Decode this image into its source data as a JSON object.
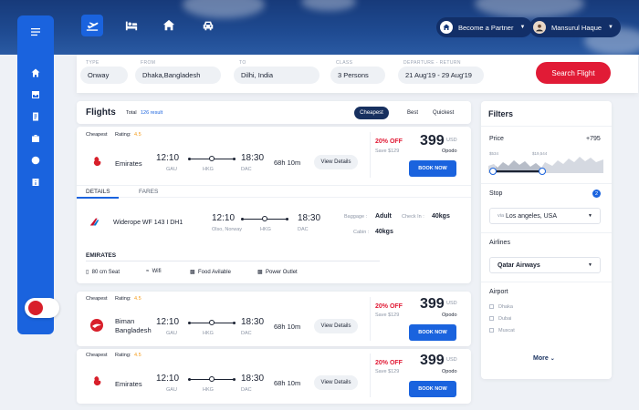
{
  "header": {
    "partner_label": "Become a Partner",
    "user_name": "Mansurul Haque",
    "nav_icons": [
      "flight-icon",
      "hotel-icon",
      "home-icon",
      "car-icon"
    ]
  },
  "search": {
    "type_label": "TYPE",
    "type_value": "Onway",
    "from_label": "FROM",
    "from_value": "Dhaka,Bangladesh",
    "to_label": "TO",
    "to_value": "Dilhi, India",
    "class_label": "CLASS",
    "class_value": "3 Persons",
    "dates_label": "DEPARTURE - RETURN",
    "dates_value": "21 Aug'19  -  29 Aug'19",
    "button": "Search  Flight"
  },
  "flights": {
    "title": "Flights",
    "total_label": "Total",
    "total_count": "126 result",
    "sort_tabs": [
      "Cheapest",
      "Best",
      "Quickest"
    ],
    "details_tabs": [
      "DETAILS",
      "FARES"
    ],
    "items": [
      {
        "tag": "Cheapest",
        "rating_label": "Rating:",
        "rating": "4.5",
        "airline": "Emirates",
        "dep_time": "12:10",
        "dep_code": "GAU",
        "stop_code": "HKG",
        "arr_time": "18:30",
        "arr_code": "DAC",
        "duration": "68h 10m",
        "discount": "20% OFF",
        "save": "Save $129",
        "price": "399",
        "currency": "USD",
        "agent": "Opodo",
        "view": "View Details",
        "book": "BOOK NOW"
      },
      {
        "tag": "Cheapest",
        "rating_label": "Rating:",
        "rating": "4.5",
        "airline": "Biman Bangladesh",
        "dep_time": "12:10",
        "dep_code": "GAU",
        "stop_code": "HKG",
        "arr_time": "18:30",
        "arr_code": "DAC",
        "duration": "68h 10m",
        "discount": "20% OFF",
        "save": "Save $129",
        "price": "399",
        "currency": "USD",
        "agent": "Opodo",
        "view": "View Details",
        "book": "BOOK NOW"
      },
      {
        "tag": "Cheapest",
        "rating_label": "Rating:",
        "rating": "4.5",
        "airline": "Emirates",
        "dep_time": "12:10",
        "dep_code": "GAU",
        "stop_code": "HKG",
        "arr_time": "18:30",
        "arr_code": "DAC",
        "duration": "68h 10m",
        "discount": "20% OFF",
        "save": "Save $129",
        "price": "399",
        "currency": "USD",
        "agent": "Opodo",
        "view": "View Details",
        "book": "BOOK NOW"
      }
    ],
    "detail": {
      "flight": "Widerope WF 143 I DH1",
      "dep_time": "12:10",
      "dep_loc": "Olso, Norway",
      "stop": "HKG",
      "arr_time": "18:30",
      "arr_code": "DAC",
      "baggage_label": "Baggage :",
      "baggage_value": "Adult",
      "checkin_label": "Check In :",
      "checkin_value": "40kgs",
      "cabin_label": "Cabin :",
      "cabin_value": "40kgs",
      "section": "EMIRATES",
      "amenities": [
        "80 cm Seat",
        "Wifi",
        "Food Avilable",
        "Power Outlet"
      ]
    }
  },
  "filters": {
    "title": "Filters",
    "price_label": "Price",
    "price_max": "+795",
    "price_lo": "$534",
    "price_hi": "$19,544",
    "stop_label": "Stop",
    "stop_count": "2",
    "stop_prefix": "via",
    "stop_value": "Los angeles, USA",
    "airlines_label": "Airlines",
    "airline_value": "Qatar Airways",
    "airport_label": "Airport",
    "airports": [
      "Dhaka",
      "Dubai",
      "Muscat"
    ],
    "more": "More"
  },
  "colors": {
    "accent": "#1a63de",
    "brand_red": "#e11b36",
    "navy": "#173a7a"
  }
}
